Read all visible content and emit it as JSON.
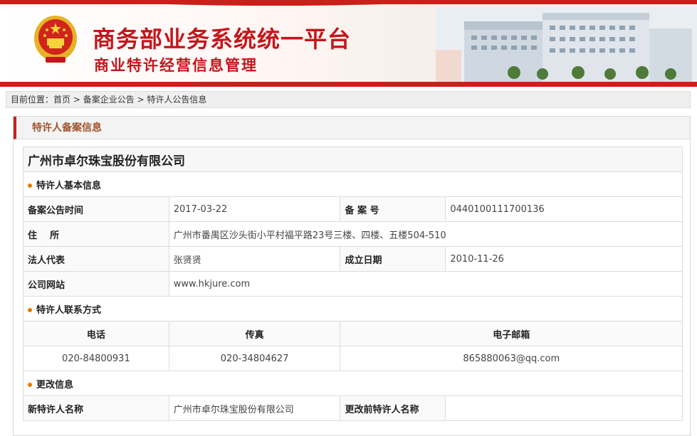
{
  "header": {
    "title_main": "商务部业务系统统一平台",
    "title_sub": "商业特许经营信息管理"
  },
  "breadcrumb": {
    "label": "目前位置：",
    "path": "首页 > 备案企业公告 > 特许人公告信息"
  },
  "panel": {
    "title": "特许人备案信息",
    "company_name": "广州市卓尔珠宝股份有限公司",
    "basic_section": "特许人基本信息",
    "basic": {
      "announce_time_label": "备案公告时间",
      "announce_time": "2017-03-22",
      "record_no_label": "备 案 号",
      "record_no": "0440100111700136",
      "address_label": "住    所",
      "address": "广州市番禺区沙头街小平村福平路23号三楼、四楼、五楼504-510",
      "legal_rep_label": "法人代表",
      "legal_rep": "张贤贤",
      "established_label": "成立日期",
      "established": "2010-11-26",
      "website_label": "公司网站",
      "website": "www.hkjure.com"
    },
    "contact_section": "特许人联系方式",
    "contact": {
      "phone_label": "电话",
      "fax_label": "传真",
      "email_label": "电子邮箱",
      "phone": "020-84800931",
      "fax": "020-34804627",
      "email": "865880063@qq.com"
    },
    "change_section": "更改信息",
    "change": {
      "new_name_label": "新特许人名称",
      "new_name": "广州市卓尔珠宝股份有限公司",
      "old_name_label": "更改前特许人名称",
      "old_name": ""
    }
  }
}
